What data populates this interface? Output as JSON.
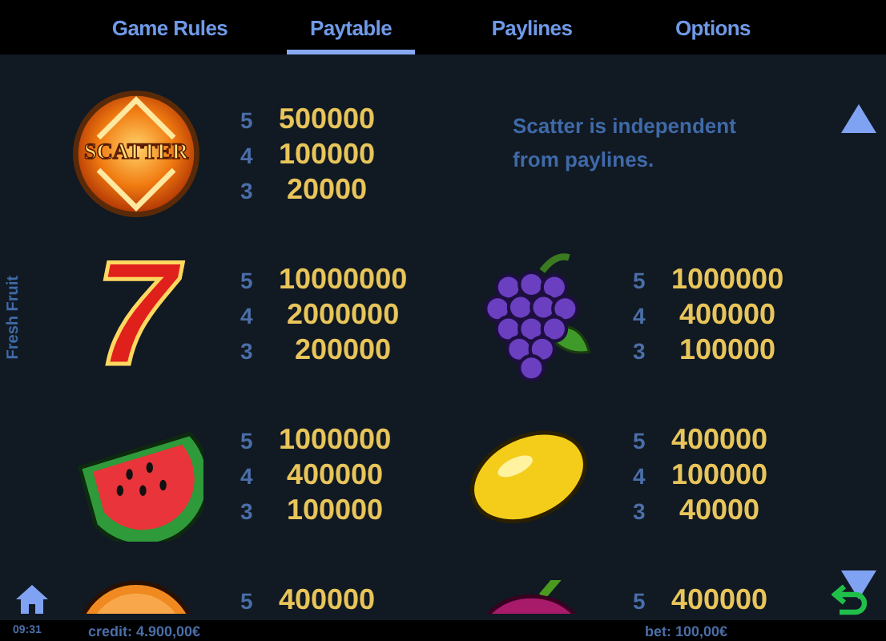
{
  "tabs": [
    {
      "label": "Game Rules",
      "selected": false
    },
    {
      "label": "Paytable",
      "selected": true
    },
    {
      "label": "Paylines",
      "selected": false
    },
    {
      "label": "Options",
      "selected": false
    }
  ],
  "category": "Fresh Fruit",
  "symbols": [
    {
      "kind": "scatter",
      "label": "SCATTER",
      "pays": [
        {
          "count": "5",
          "amount": "500000"
        },
        {
          "count": "4",
          "amount": "100000"
        },
        {
          "count": "3",
          "amount": "20000"
        }
      ],
      "note": "Scatter is independent from paylines."
    },
    {
      "kind": "seven",
      "label": "7",
      "pays": [
        {
          "count": "5",
          "amount": "10000000"
        },
        {
          "count": "4",
          "amount": "2000000"
        },
        {
          "count": "3",
          "amount": "200000"
        }
      ]
    },
    {
      "kind": "grapes",
      "pays": [
        {
          "count": "5",
          "amount": "1000000"
        },
        {
          "count": "4",
          "amount": "400000"
        },
        {
          "count": "3",
          "amount": "100000"
        }
      ]
    },
    {
      "kind": "watermelon",
      "pays": [
        {
          "count": "5",
          "amount": "1000000"
        },
        {
          "count": "4",
          "amount": "400000"
        },
        {
          "count": "3",
          "amount": "100000"
        }
      ]
    },
    {
      "kind": "lemon",
      "pays": [
        {
          "count": "5",
          "amount": "400000"
        },
        {
          "count": "4",
          "amount": "100000"
        },
        {
          "count": "3",
          "amount": "40000"
        }
      ]
    },
    {
      "kind": "orange",
      "pays": [
        {
          "count": "5",
          "amount": "400000"
        }
      ]
    },
    {
      "kind": "plum",
      "pays": [
        {
          "count": "5",
          "amount": "400000"
        }
      ]
    }
  ],
  "status_bar": {
    "time": "09:31",
    "credit": "credit: 4.900,00€",
    "bet": "bet: 100,00€"
  }
}
